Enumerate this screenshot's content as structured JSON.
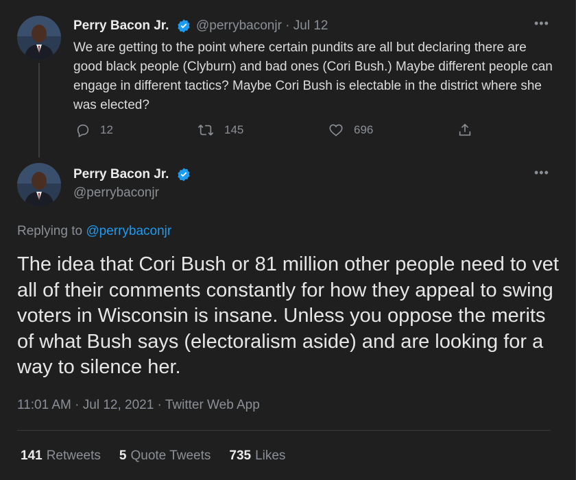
{
  "tweet_parent": {
    "author_name": "Perry Bacon Jr.",
    "handle_date": "@perrybaconjr · Jul 12",
    "text": "We are getting to the point where certain pundits are all but declaring there are good black people (Clyburn) and bad ones (Cori Bush.) Maybe different people can engage in different tactics? Maybe Cori Bush is electable in the district where she was elected?",
    "replies": "12",
    "retweets": "145",
    "likes": "696"
  },
  "tweet_main": {
    "author_name": "Perry Bacon Jr.",
    "handle": "@perrybaconjr",
    "replying_prefix": "Replying to",
    "replying_handle": "@perrybaconjr",
    "text": "The idea that Cori Bush or 81 million other people need to vet all of their comments constantly for how they appeal to swing voters in Wisconsin is insane. Unless you oppose the merits of what Bush says (electoralism aside) and are looking for a way to silence her.",
    "meta": "11:01 AM · Jul 12, 2021 · Twitter Web App",
    "stats": {
      "retweets_count": "141",
      "retweets_label": "Retweets",
      "quotes_count": "5",
      "quotes_label": "Quote Tweets",
      "likes_count": "735",
      "likes_label": "Likes"
    }
  },
  "icons": {
    "more": "more-horizontal-icon",
    "verified": "verified-badge-icon",
    "reply": "reply-icon",
    "retweet": "retweet-icon",
    "like": "heart-icon",
    "share": "share-icon"
  },
  "colors": {
    "background": "#1f1f1f",
    "accent": "#1d9bf0",
    "muted": "#8b9096"
  }
}
